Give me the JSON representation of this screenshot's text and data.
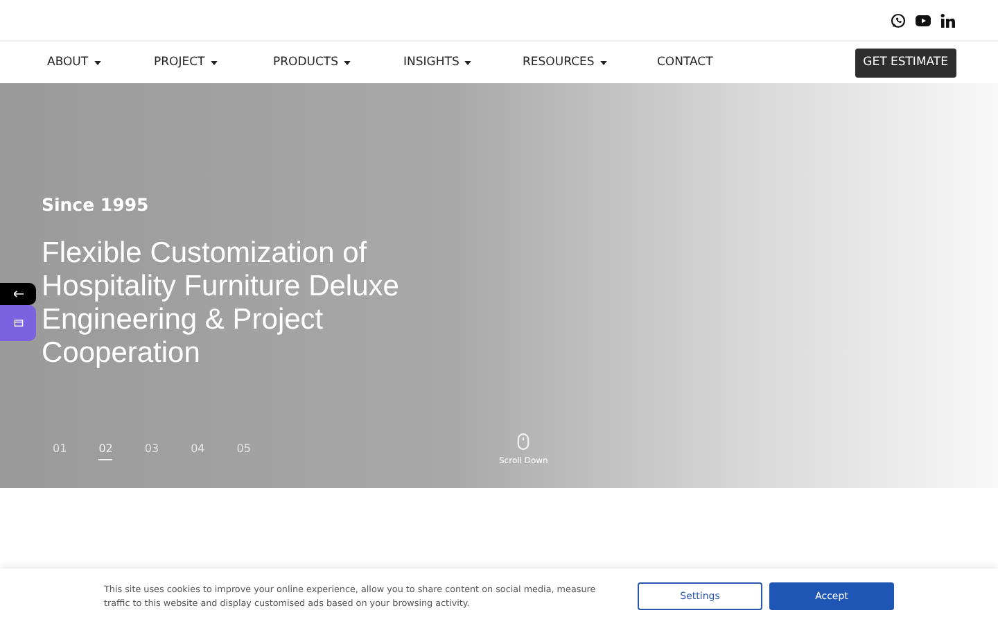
{
  "nav": {
    "items": [
      {
        "label": "ABOUT",
        "dropdown": true
      },
      {
        "label": "PROJECT",
        "dropdown": true
      },
      {
        "label": "PRODUCTS",
        "dropdown": true
      },
      {
        "label": "INSIGHTS",
        "dropdown": true
      },
      {
        "label": "RESOURCES",
        "dropdown": true
      },
      {
        "label": "CONTACT",
        "dropdown": false
      }
    ],
    "cta": "GET ESTIMATE"
  },
  "hero": {
    "eyebrow": "Since 1995",
    "title": "Flexible Customization of Hospitality Furniture Deluxe Engineering & Project Cooperation",
    "slides": [
      {
        "label": "01",
        "selected": false
      },
      {
        "label": "02",
        "selected": true
      },
      {
        "label": "03",
        "selected": false
      },
      {
        "label": "04",
        "selected": false
      },
      {
        "label": "05",
        "selected": false
      }
    ],
    "scroll_hint": "Scroll Down"
  },
  "cookie_banner": {
    "text": "This site uses cookies to improve your online experience, allow you to share content on social media, measure traffic to this website and display customised ads based on your browsing activity.",
    "settings_button": "Settings",
    "accept_button": "Accept"
  }
}
